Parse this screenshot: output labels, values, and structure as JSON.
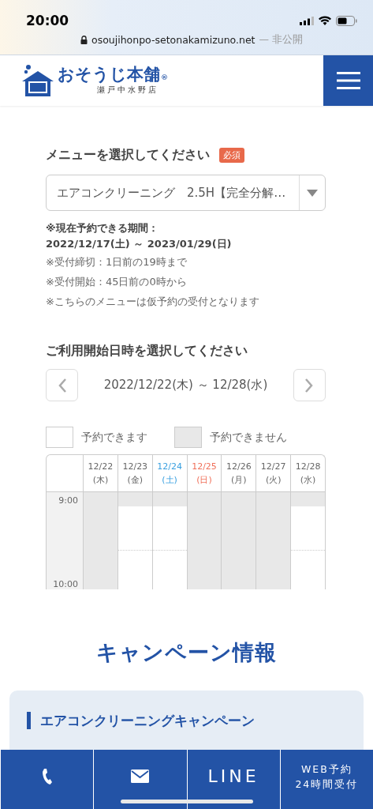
{
  "status_bar": {
    "time": "20:00",
    "url": "osoujihonpo-setonakamizuno.net",
    "url_note": "— 非公開"
  },
  "header": {
    "brand": "おそうじ本舗",
    "brand_mark": "®",
    "store": "瀬戸中水野店"
  },
  "menu_form": {
    "label": "メニューを選択してください",
    "required_badge": "必須",
    "selected_value": "エアコンクリーニング　2.5H【完全分解…",
    "period_label": "※現在予約できる期間：",
    "period": "2022/12/17(土) ～ 2023/01/29(日)",
    "notes": [
      "※受付締切：1日前の19時まで",
      "※受付開始：45日前の0時から",
      "※こちらのメニューは仮予約の受付となります"
    ]
  },
  "calendar": {
    "title": "ご利用開始日時を選択してください",
    "range": "2022/12/22(木) ～ 12/28(水)",
    "legend": [
      {
        "label": "予約できます",
        "color": "#ffffff"
      },
      {
        "label": "予約できません",
        "color": "#e8e8e8"
      }
    ],
    "times": [
      "9:00",
      "10:00"
    ],
    "days": [
      {
        "date": "12/22",
        "weekday": "(木)",
        "color": "#666666",
        "slots": [
          {
            "available": false
          },
          {
            "available": false
          },
          {
            "available": false
          }
        ]
      },
      {
        "date": "12/23",
        "weekday": "(金)",
        "color": "#666666",
        "slots": [
          {
            "available": false
          },
          {
            "available": true
          },
          {
            "available": true
          }
        ]
      },
      {
        "date": "12/24",
        "weekday": "(土)",
        "color": "#3aa0e0",
        "slots": [
          {
            "available": false
          },
          {
            "available": true
          },
          {
            "available": true
          }
        ]
      },
      {
        "date": "12/25",
        "weekday": "(日)",
        "color": "#f0705a",
        "slots": [
          {
            "available": false
          },
          {
            "available": false
          },
          {
            "available": false
          }
        ]
      },
      {
        "date": "12/26",
        "weekday": "(月)",
        "color": "#666666",
        "slots": [
          {
            "available": false
          },
          {
            "available": false
          },
          {
            "available": false
          }
        ]
      },
      {
        "date": "12/27",
        "weekday": "(火)",
        "color": "#666666",
        "slots": [
          {
            "available": false
          },
          {
            "available": false
          },
          {
            "available": false
          }
        ]
      },
      {
        "date": "12/28",
        "weekday": "(水)",
        "color": "#666666",
        "slots": [
          {
            "available": false
          },
          {
            "available": true
          },
          {
            "available": true
          }
        ]
      }
    ]
  },
  "campaign": {
    "title": "キャンペーン情報",
    "card_heading": "エアコンクリーニングキャンペーン"
  },
  "bottom_bar": [
    {
      "kind": "phone"
    },
    {
      "kind": "mail"
    },
    {
      "kind": "text",
      "label": "LINE"
    },
    {
      "kind": "two_line",
      "lines": [
        "WEB予約",
        "24時間受付"
      ]
    }
  ]
}
